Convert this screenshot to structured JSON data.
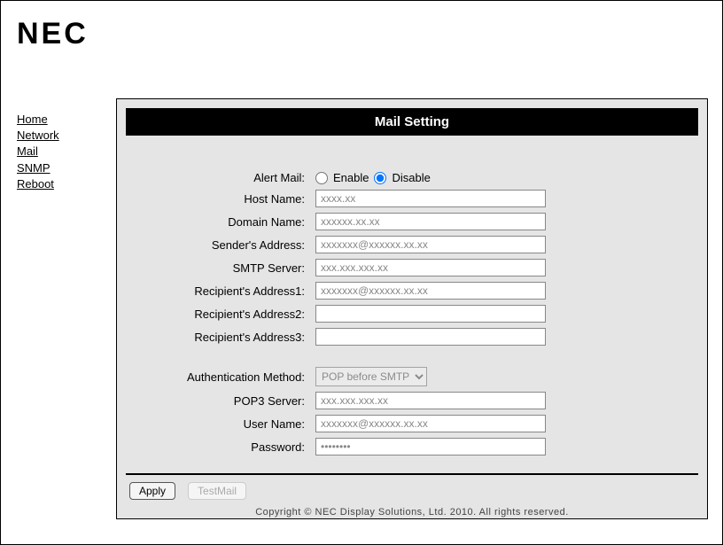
{
  "logo": "NEC",
  "sidebar": {
    "items": [
      {
        "label": "Home"
      },
      {
        "label": "Network"
      },
      {
        "label": "Mail"
      },
      {
        "label": "SNMP"
      },
      {
        "label": "Reboot"
      }
    ]
  },
  "panel": {
    "title": "Mail Setting"
  },
  "form": {
    "alert_mail_label": "Alert Mail:",
    "alert_mail_enable": "Enable",
    "alert_mail_disable": "Disable",
    "alert_mail_selected": "disable",
    "host_name_label": "Host Name:",
    "host_name_value": "xxxx.xx",
    "domain_name_label": "Domain Name:",
    "domain_name_value": "xxxxxx.xx.xx",
    "sender_addr_label": "Sender's Address:",
    "sender_addr_value": "xxxxxxx@xxxxxx.xx.xx",
    "smtp_label": "SMTP Server:",
    "smtp_value": "xxx.xxx.xxx.xx",
    "recip1_label": "Recipient's Address1:",
    "recip1_value": "xxxxxxx@xxxxxx.xx.xx",
    "recip2_label": "Recipient's Address2:",
    "recip2_value": "",
    "recip3_label": "Recipient's Address3:",
    "recip3_value": "",
    "auth_method_label": "Authentication Method:",
    "auth_method_value": "POP before SMTP",
    "pop3_label": "POP3 Server:",
    "pop3_value": "xxx.xxx.xxx.xx",
    "user_label": "User Name:",
    "user_value": "xxxxxxx@xxxxxx.xx.xx",
    "pass_label": "Password:",
    "pass_value": "••••••••"
  },
  "buttons": {
    "apply": "Apply",
    "testmail": "TestMail"
  },
  "copyright": "Copyright © NEC Display Solutions, Ltd. 2010. All rights reserved."
}
